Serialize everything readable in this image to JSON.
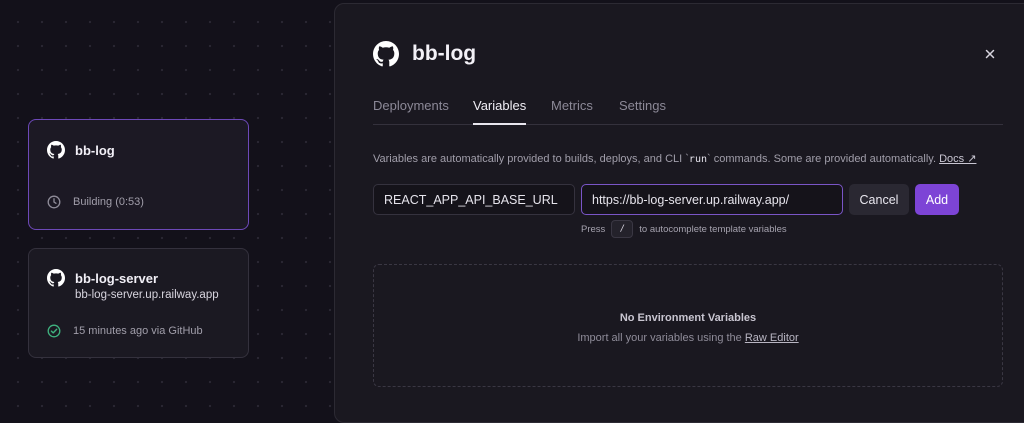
{
  "sidebar": {
    "cards": [
      {
        "name": "bb-log",
        "status": "Building (0:53)"
      },
      {
        "name": "bb-log-server",
        "url": "bb-log-server.up.railway.app",
        "status": "15 minutes ago via GitHub"
      }
    ]
  },
  "panel": {
    "title": "bb-log",
    "tabs": [
      "Deployments",
      "Variables",
      "Metrics",
      "Settings"
    ],
    "active_tab": "Variables",
    "description": {
      "before": "Variables are automatically provided to builds, deploys, and CLI `",
      "code": "run",
      "after": "` commands. Some are provided automatically.",
      "docs_label": "Docs ↗"
    },
    "form": {
      "name_value": "REACT_APP_API_BASE_URL",
      "value_value": "https://bb-log-server.up.railway.app/",
      "cancel_label": "Cancel",
      "add_label": "Add",
      "hint_before": "Press",
      "hint_key": "/",
      "hint_after": "to autocomplete template variables"
    },
    "empty": {
      "title": "No Environment Variables",
      "text": "Import all your variables using the",
      "link": "Raw Editor"
    }
  },
  "colors": {
    "accent": "#7d44d6",
    "building_border": "#6d49b8",
    "success": "#3fb27f"
  }
}
